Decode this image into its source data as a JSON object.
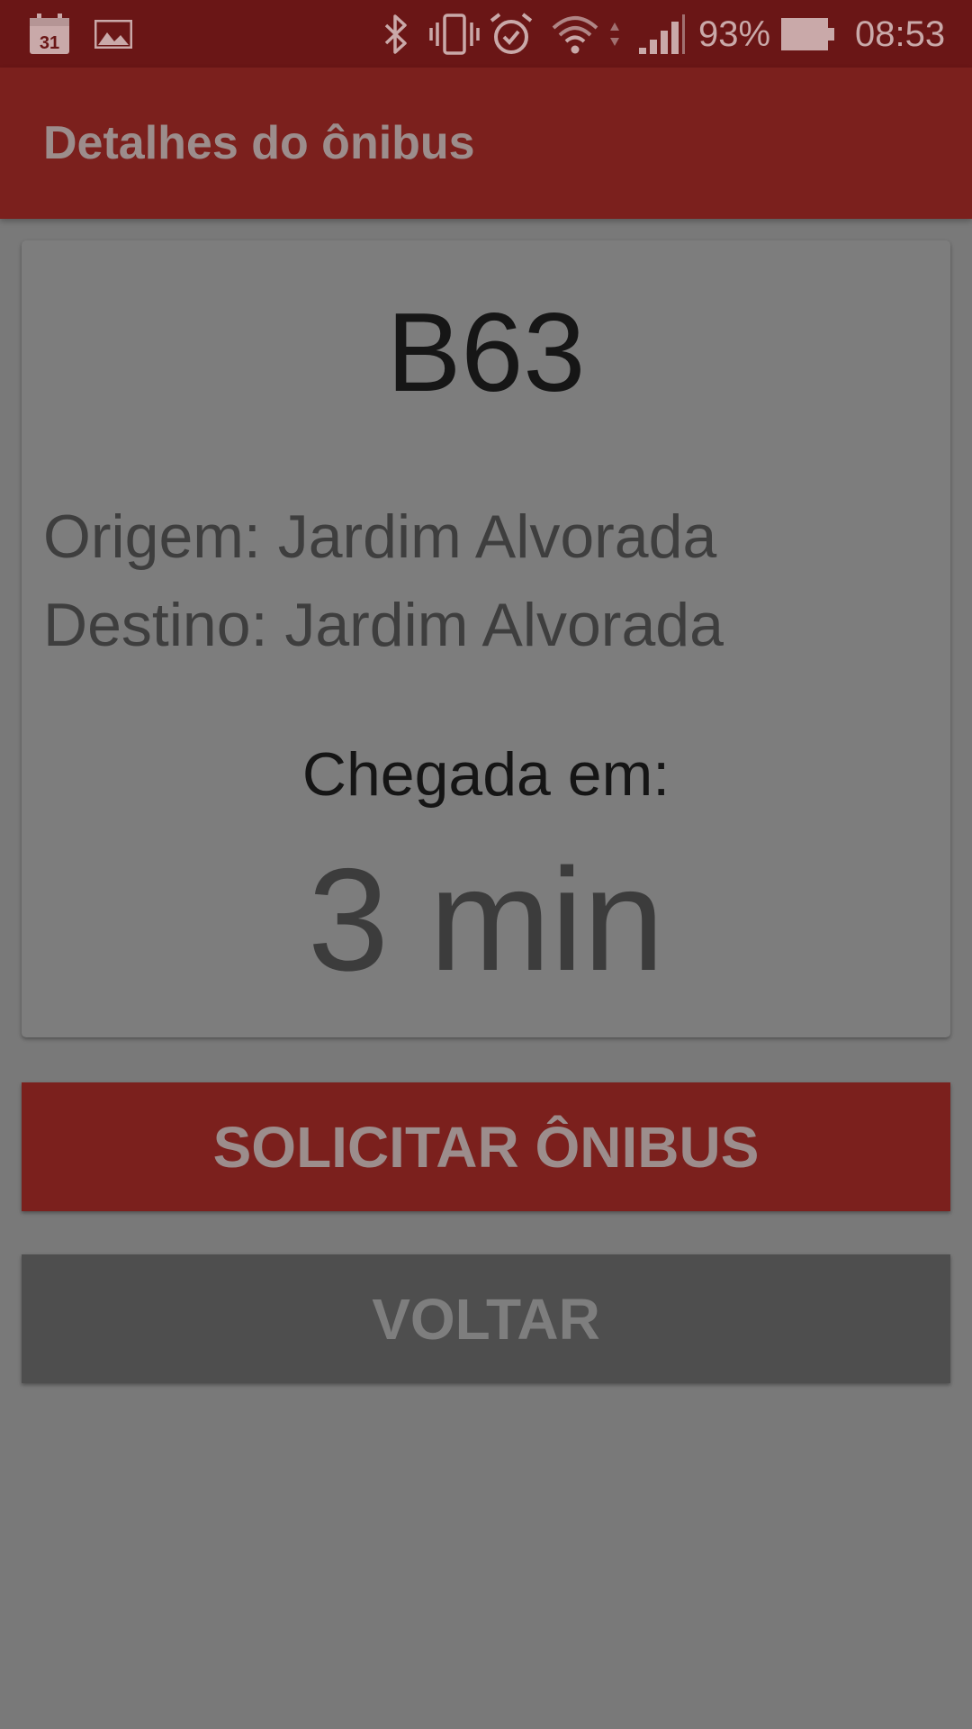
{
  "status_bar": {
    "calendar_day": "31",
    "battery": "93%",
    "time": "08:53",
    "icons": [
      "calendar-icon",
      "image-icon",
      "bluetooth-icon",
      "vibrate-icon",
      "alarm-icon",
      "wifi-icon",
      "signal-icon",
      "battery-icon"
    ]
  },
  "app_bar": {
    "title": "Detalhes do ônibus"
  },
  "bus_details": {
    "line": "B63",
    "origin": "Origem: Jardim Alvorada",
    "destination": "Destino: Jardim Alvorada",
    "arrival_label": "Chegada em:",
    "arrival_value": "3 min"
  },
  "actions": {
    "request_label": "SOLICITAR ÔNIBUS",
    "back_label": "VOLTAR"
  },
  "colors": {
    "status_bar": "#6a1616",
    "app_bar": "#7b201d",
    "background": "#797979",
    "card": "#7d7d7d",
    "back_button": "#4e4e4e"
  }
}
